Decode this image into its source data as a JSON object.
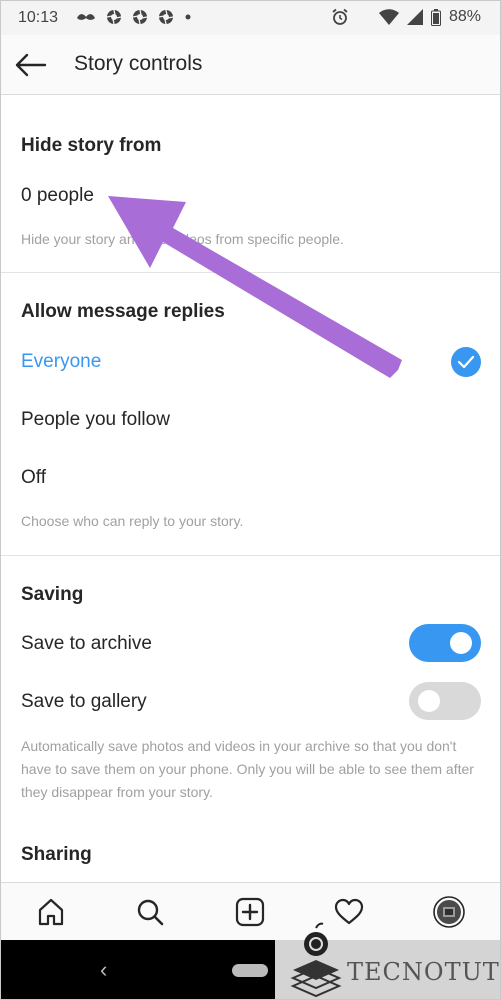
{
  "status_bar": {
    "time": "10:13",
    "battery": "88%",
    "icons": [
      "mustache-icon",
      "aperture-icon",
      "aperture-icon",
      "aperture-icon",
      "dot-icon",
      "alarm-icon",
      "wifi-icon",
      "signal-icon",
      "battery-icon"
    ]
  },
  "app_bar": {
    "title": "Story controls",
    "back_icon": "back-arrow-icon"
  },
  "hide_story": {
    "title": "Hide story from",
    "value": "0 people",
    "helper": "Hide your story and live videos from specific people."
  },
  "message_replies": {
    "title": "Allow message replies",
    "options": [
      {
        "label": "Everyone",
        "selected": true
      },
      {
        "label": "People you follow",
        "selected": false
      },
      {
        "label": "Off",
        "selected": false
      }
    ],
    "helper": "Choose who can reply to your story."
  },
  "saving": {
    "title": "Saving",
    "items": [
      {
        "label": "Save to archive",
        "enabled": true
      },
      {
        "label": "Save to gallery",
        "enabled": false
      }
    ],
    "helper": "Automatically save photos and videos in your archive so that you don't have to save them on your phone. Only you will be able to see them after they disappear from your story."
  },
  "sharing": {
    "title": "Sharing"
  },
  "tab_bar": {
    "tabs": [
      "home-icon",
      "search-icon",
      "add-post-icon",
      "heart-icon",
      "profile-avatar"
    ]
  },
  "watermark": {
    "text": "TECNOTUTO"
  },
  "colors": {
    "accent": "#3897f0",
    "arrow": "#a86dd6",
    "toggle_off": "#d9d9d9"
  }
}
